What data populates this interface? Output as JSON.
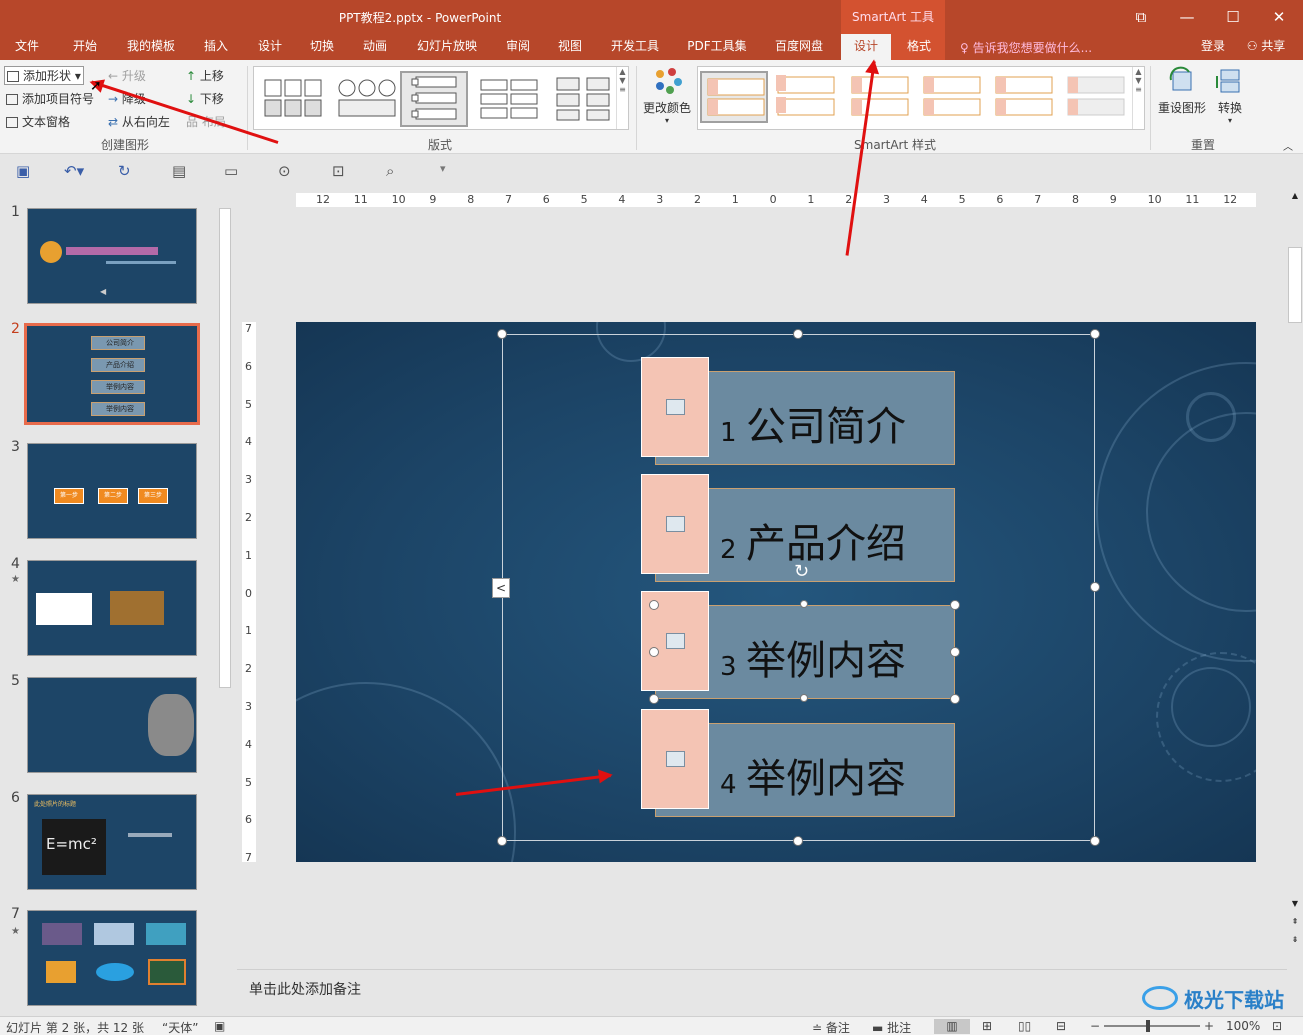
{
  "window": {
    "title": "PPT教程2.pptx - PowerPoint",
    "context_tab": "SmartArt 工具",
    "restore_glyph": "⧉",
    "minimize_glyph": "—",
    "maximize_glyph": "☐",
    "close_glyph": "✕"
  },
  "menu": {
    "tabs": [
      "文件",
      "开始",
      "我的模板",
      "插入",
      "设计",
      "切换",
      "动画",
      "幻灯片放映",
      "审阅",
      "视图",
      "开发工具",
      "PDF工具集",
      "百度网盘",
      "设计",
      "格式"
    ],
    "active_index": 13,
    "tell_me": "告诉我您想要做什么...",
    "login": "登录",
    "share": "共享"
  },
  "ribbon": {
    "create_group": {
      "label": "创建图形",
      "add_shape": "添加形状",
      "add_bullet": "添加项目符号",
      "text_pane": "文本窗格",
      "promote": "升级",
      "demote": "降级",
      "right_to_left": "从右向左",
      "move_up": "上移",
      "move_down": "下移",
      "layout_btn": "布局"
    },
    "layouts_group": {
      "label": "版式"
    },
    "styles_group": {
      "label": "SmartArt 样式",
      "change_colors": "更改颜色"
    },
    "reset_group": {
      "label": "重置",
      "reset_graphic": "重设图形",
      "convert": "转换"
    }
  },
  "thumbnails": [
    {
      "num": "1",
      "star": ""
    },
    {
      "num": "2",
      "star": "",
      "items": [
        "公司简介",
        "产品介绍",
        "举例内容",
        "举例内容"
      ]
    },
    {
      "num": "3",
      "star": "",
      "steps": [
        "第一步",
        "第二步",
        "第三步"
      ]
    },
    {
      "num": "4",
      "star": "★"
    },
    {
      "num": "5",
      "star": ""
    },
    {
      "num": "6",
      "star": "",
      "title": "此处照片的标题",
      "formula": "E=mc²"
    },
    {
      "num": "7",
      "star": "★"
    }
  ],
  "rulers": {
    "h_labels": [
      "12",
      "11",
      "10",
      "9",
      "8",
      "7",
      "6",
      "5",
      "4",
      "3",
      "2",
      "1",
      "0",
      "1",
      "2",
      "3",
      "4",
      "5",
      "6",
      "7",
      "8",
      "9",
      "10",
      "11",
      "12"
    ],
    "v_labels": [
      "7",
      "6",
      "5",
      "4",
      "3",
      "2",
      "1",
      "0",
      "1",
      "2",
      "3",
      "4",
      "5",
      "6",
      "7"
    ]
  },
  "smartart": {
    "items": [
      {
        "num": "1",
        "text": "公司简介"
      },
      {
        "num": "2",
        "text": "产品介绍"
      },
      {
        "num": "3",
        "text": "举例内容"
      },
      {
        "num": "4",
        "text": "举例内容"
      }
    ],
    "pane_toggle": "<"
  },
  "notes": {
    "placeholder": "单击此处添加备注"
  },
  "status": {
    "slide_info": "幻灯片 第 2 张，共 12 张",
    "font": "“天体”",
    "notes_btn": "备注",
    "comments_btn": "批注",
    "zoom": "100%"
  },
  "watermark": "极光下载站",
  "colors": {
    "accent": "#b7472a",
    "context": "#d35230",
    "slide_bg": "#1c4466",
    "picture_fill": "#f4c4b4",
    "box_fill": "#6b8aa0"
  }
}
